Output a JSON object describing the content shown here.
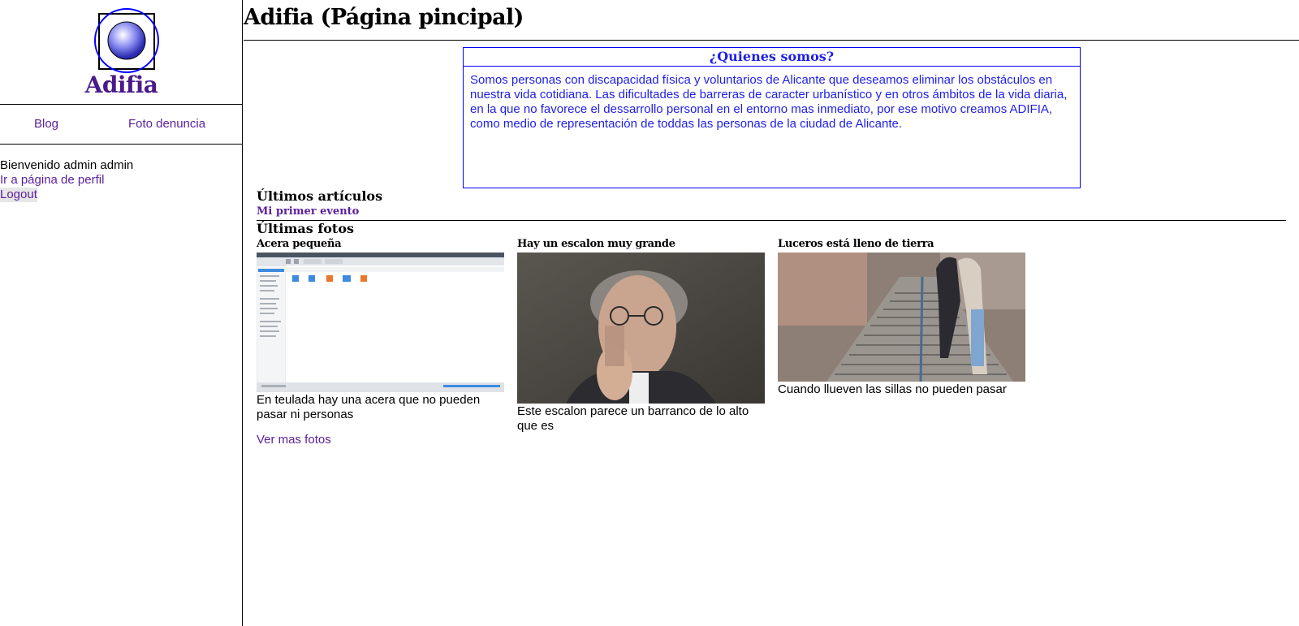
{
  "sidebar": {
    "logo_text": "Adifia",
    "nav": {
      "blog": "Blog",
      "foto_denuncia": "Foto denuncia"
    },
    "user": {
      "welcome": "Bienvenido admin admin",
      "profile_link": "Ir a página de perfil",
      "logout": "Logout"
    }
  },
  "header": {
    "title": "Adifia (Página pincipal)"
  },
  "about": {
    "title": "¿Quienes somos?",
    "text": "Somos personas con discapacidad física y voluntarios de Alicante que deseamos eliminar los obstáculos en nuestra vida cotidiana. Las dificultades de barreras de caracter urbanístico y en otros ámbitos de la vida diaria, en la que no favorece el dessarrollo personal en el entorno mas inmediato, por ese motivo creamos ADIFIA, como medio de representación de toddas las personas de la ciudad de Alicante."
  },
  "articles": {
    "title": "Últimos artículos",
    "items": [
      "Mi primer evento"
    ]
  },
  "photos": {
    "title": "Últimas fotos",
    "items": [
      {
        "title": "Acera pequeña",
        "description": "En teulada hay una acera que no pueden pasar ni personas"
      },
      {
        "title": "Hay un escalon muy grande",
        "description": "Este escalon parece un barranco de lo alto que es"
      },
      {
        "title": "Luceros está lleno de tierra",
        "description": "Cuando llueven las sillas no pueden pasar"
      }
    ],
    "more_link": "Ver mas fotos"
  },
  "colors": {
    "link": "#5b1f9c",
    "about_blue": "#1e1ee6",
    "logo_purple": "#4a1a8a"
  }
}
